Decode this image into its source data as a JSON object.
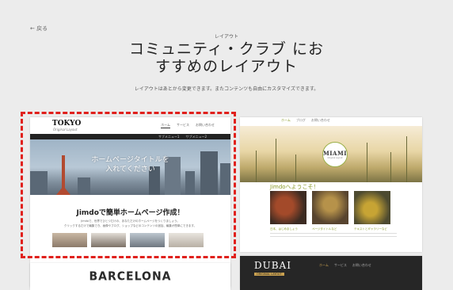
{
  "nav": {
    "back_label": "← 戻る"
  },
  "header": {
    "eyebrow": "レイアウト",
    "title_line1": "コミュニティ・クラブ にお",
    "title_line2": "すすめのレイアウト",
    "subtitle": "レイアウトはあとから変更できます。またコンテンツも自由にカスタマイズできます。"
  },
  "layouts": {
    "tokyo": {
      "logo": "TOKYO",
      "logo_sub": "Original Layout",
      "nav": [
        "ホーム",
        "サービス",
        "お問い合わせ"
      ],
      "subnav": [
        "サブメニュー1",
        "サブメニュー2"
      ],
      "hero_line1": "ホームページタイトルを",
      "hero_line2": "入れてください",
      "headline": "Jimdoで簡単ホームページ作成！",
      "body_line1": "Jimdoで、世界でひとつだけの、あなただけのホームページをつくりましょう。",
      "body_line2": "クリックするだけで編集でき、画像やブログ、ショップなどのコンテンツの追加、編集が簡単にできます。"
    },
    "miami": {
      "nav": [
        "ホーム",
        "ブログ",
        "お問い合わせ"
      ],
      "logo": "MIAMI",
      "logo_sub": "Original Layout",
      "welcome": "Jimdoへようこそ！",
      "captions": [
        "日本、はじめましょう",
        "ページタイトルなど",
        "テキストとギャラリーなど"
      ]
    },
    "dubai": {
      "logo": "DUBAI",
      "tag": "ORIGINAL LAYOUT",
      "nav": [
        "ホーム",
        "サービス",
        "お問い合わせ"
      ]
    },
    "barcelona": {
      "logo": "BARCELONA"
    }
  },
  "colors": {
    "highlight_border": "#e0201c",
    "miami_accent": "#8a9a2a",
    "dubai_accent": "#c8a050"
  }
}
